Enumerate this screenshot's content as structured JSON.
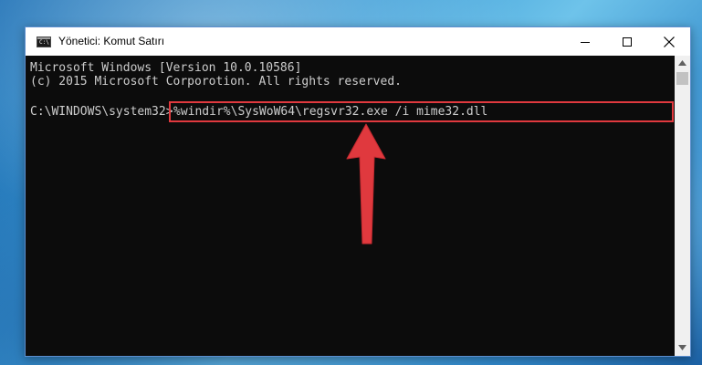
{
  "window": {
    "title": "Yönetici: Komut Satırı",
    "icon": "command-prompt-icon",
    "controls": {
      "minimize_icon": "minimize-icon",
      "maximize_icon": "maximize-icon",
      "close_icon": "close-icon"
    }
  },
  "console": {
    "lines": [
      "Microsoft Windows [Version 10.0.10586]",
      "(c) 2015 Microsoft Corporotion. All rights reserved."
    ],
    "prompt": "C:\\WINDOWS\\system32>",
    "command": "%windir%\\SysWoW64\\regsvr32.exe /i mime32.dll",
    "text_color": "#cccccc",
    "background": "#0c0c0c"
  },
  "annotation": {
    "highlight_color": "#e0393e",
    "arrow_icon": "up-arrow-icon"
  },
  "scrollbar": {
    "up_icon": "scroll-up-icon",
    "down_icon": "scroll-down-icon"
  }
}
